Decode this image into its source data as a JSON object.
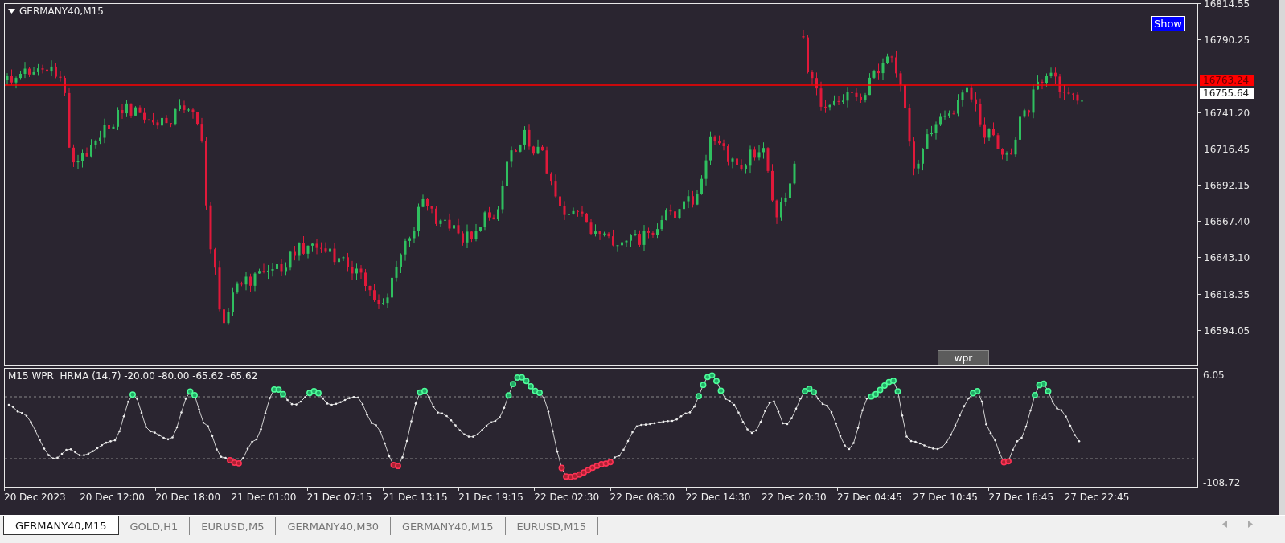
{
  "chart": {
    "title": "GERMANY40,M15",
    "show_button": "Show",
    "indicator_button": "wpr"
  },
  "price_axis": {
    "labels": [
      "16814.55",
      "16790.25",
      "16741.20",
      "16716.45",
      "16692.15",
      "16667.40",
      "16643.10",
      "16618.35",
      "16594.05"
    ],
    "tags": [
      {
        "kind": "bid",
        "text": "16763.24"
      },
      {
        "kind": "last",
        "text": "16755.64"
      }
    ]
  },
  "indicator": {
    "title": "M15 WPR  HRMA (14,7) -20.00 -80.00 -65.62 -65.62",
    "axis_labels": [
      "6.05",
      "-108.72"
    ]
  },
  "time_axis": [
    "20 Dec 2023",
    "20 Dec 12:00",
    "20 Dec 18:00",
    "21 Dec 01:00",
    "21 Dec 07:15",
    "21 Dec 13:15",
    "21 Dec 19:15",
    "22 Dec 02:30",
    "22 Dec 08:30",
    "22 Dec 14:30",
    "22 Dec 20:30",
    "27 Dec 04:45",
    "27 Dec 10:45",
    "27 Dec 16:45",
    "27 Dec 22:45"
  ],
  "tabs": [
    {
      "label": "GERMANY40,M15",
      "selected": true
    },
    {
      "label": "GOLD,H1",
      "selected": false
    },
    {
      "label": "EURUSD,M5",
      "selected": false
    },
    {
      "label": "GERMANY40,M30",
      "selected": false
    },
    {
      "label": "GERMANY40,M15",
      "selected": false
    },
    {
      "label": "EURUSD,M15",
      "selected": false
    }
  ]
}
